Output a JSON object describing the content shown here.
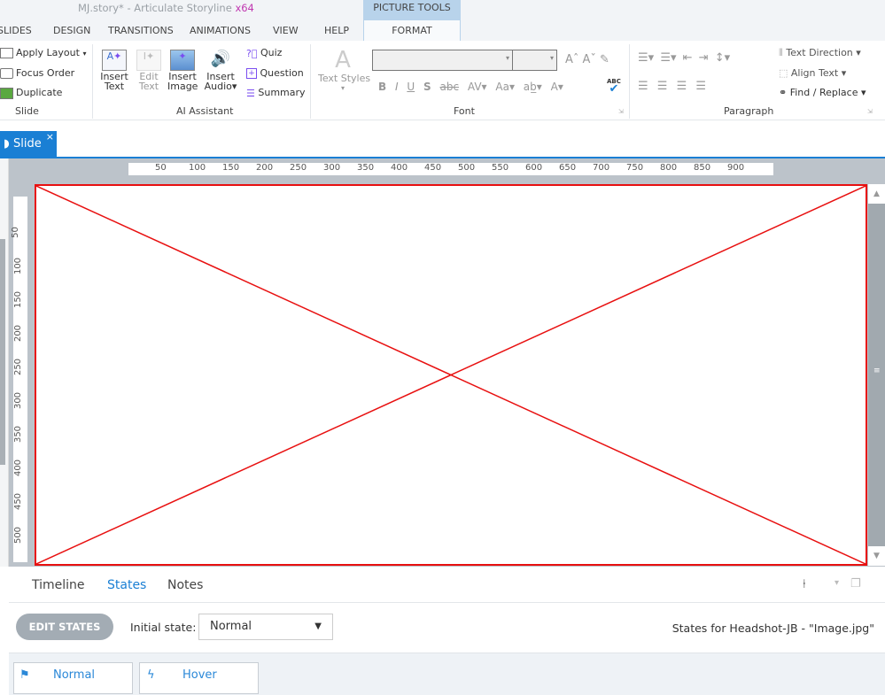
{
  "window": {
    "title": "MJ.story* -  Articulate Storyline",
    "arch": "x64",
    "context_tab_group": "PICTURE TOOLS"
  },
  "tabs": [
    "SLIDES",
    "DESIGN",
    "TRANSITIONS",
    "ANIMATIONS",
    "VIEW",
    "HELP",
    "FORMAT"
  ],
  "ribbon": {
    "slide": {
      "label": "Slide",
      "items": [
        "Apply Layout",
        "Focus Order",
        "Duplicate"
      ]
    },
    "ai": {
      "label": "AI Assistant",
      "insert_text": [
        "Insert",
        "Text"
      ],
      "edit_text": [
        "Edit",
        "Text"
      ],
      "insert_image": [
        "Insert",
        "Image"
      ],
      "insert_audio": [
        "Insert",
        "Audio"
      ],
      "quiz": "Quiz",
      "question": "Question",
      "summary": "Summary"
    },
    "font": {
      "label": "Font",
      "text_styles": "Text Styles",
      "bold": "B",
      "italic": "I",
      "underline": "U",
      "shadow": "S",
      "strike": "abc",
      "spacing": "AV",
      "case": "Aa",
      "color": "A",
      "spell": "ABC"
    },
    "paragraph": {
      "label": "Paragraph",
      "text_direction": "Text Direction",
      "align_text": "Align Text",
      "find_replace": "Find / Replace"
    }
  },
  "document_tab": {
    "label": "Slide",
    "close": "×"
  },
  "ruler": {
    "h": [
      "50",
      "100",
      "150",
      "200",
      "250",
      "300",
      "350",
      "400",
      "450",
      "500",
      "550",
      "600",
      "650",
      "700",
      "750",
      "800",
      "850",
      "900"
    ],
    "v": [
      "50",
      "100",
      "150",
      "200",
      "250",
      "300",
      "350",
      "400",
      "450",
      "500"
    ]
  },
  "bottom": {
    "tabs": [
      "Timeline",
      "States",
      "Notes"
    ],
    "active_tab": "States",
    "edit_states": "EDIT STATES",
    "initial_state_label": "Initial state:",
    "initial_state_value": "Normal",
    "states_for": "States for Headshot-JB - \"Image.jpg\"",
    "states": [
      {
        "name": "Normal",
        "icon": "flag-icon"
      },
      {
        "name": "Hover",
        "icon": "lightning-icon"
      }
    ]
  },
  "colors": {
    "accent": "#1a7fd4",
    "placeholder_border": "#e81010"
  }
}
